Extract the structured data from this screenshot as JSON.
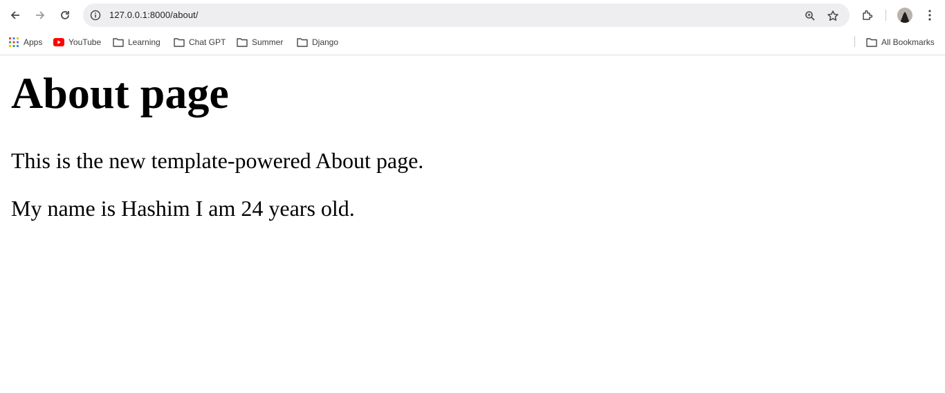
{
  "browser": {
    "url": "127.0.0.1:8000/about/",
    "bookmarks": [
      {
        "label": "Apps",
        "icon": "apps-grid-icon"
      },
      {
        "label": "YouTube",
        "icon": "youtube-icon"
      },
      {
        "label": "Learning",
        "icon": "folder-icon"
      },
      {
        "label": "Chat GPT",
        "icon": "folder-icon"
      },
      {
        "label": "Summer",
        "icon": "folder-icon"
      },
      {
        "label": "Django",
        "icon": "folder-icon"
      }
    ],
    "all_bookmarks_label": "All Bookmarks"
  },
  "page": {
    "heading": "About page",
    "paragraphs": [
      "This is the new template-powered About page.",
      "My name is Hashim I am 24 years old."
    ]
  }
}
